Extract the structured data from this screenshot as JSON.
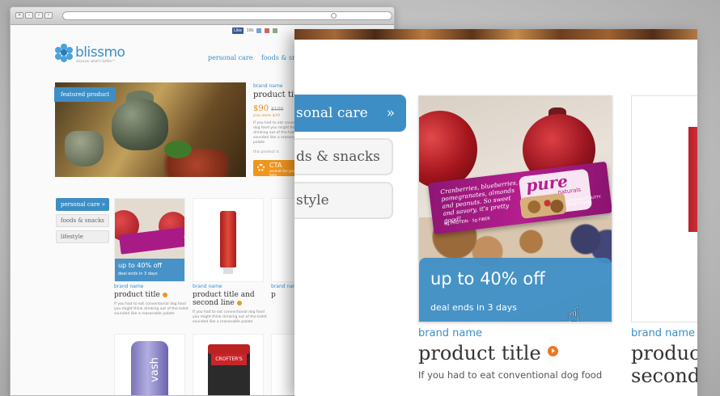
{
  "site": {
    "logo_text": "blissmo",
    "logo_tagline": "discover what's better™",
    "nav": [
      "personal care",
      "foods & snacks"
    ],
    "social": {
      "like": "Like",
      "count": "16k"
    }
  },
  "featured": {
    "tag": "featured product",
    "brand": "brand name",
    "title": "product title",
    "price": "$90",
    "old_price": "$100",
    "price_note": "you save $10",
    "desc": "If you had to eat conventional dog food you might think drinking out of the toilet sounded like a reasonable palate",
    "this_product": "this product is",
    "cta_label": "CTA",
    "cta_sub": "second line goes here"
  },
  "sidebar": {
    "items": [
      {
        "label": "personal care",
        "active": true
      },
      {
        "label": "foods & snacks",
        "active": false
      },
      {
        "label": "lifestyle",
        "active": false
      }
    ]
  },
  "grid": {
    "items": [
      {
        "brand": "brand name",
        "title": "product title",
        "deal": "up to 40% off",
        "deal_sub": "deal ends in 3 days",
        "desc": "If you had to eat conventional dog food you might think drinking out of the toilet sounded like a reasonable palate"
      },
      {
        "brand": "brand name",
        "title": "product title and second line",
        "desc": "If you had to eat conventional dog food you might think drinking out of the toilet sounded like a reasonable palate"
      },
      {
        "brand": "brand name",
        "title": "p"
      }
    ],
    "row2": [
      {
        "label": "vash"
      },
      {
        "label": "CROFTER'S"
      }
    ]
  },
  "zoom": {
    "nav": [
      {
        "label": "sonal care",
        "active": true
      },
      {
        "label": "ds & snacks",
        "active": false
      },
      {
        "label": "style",
        "active": false
      }
    ],
    "nav_chevron": "»",
    "card": {
      "bar_text": "Cranberries, blueberries, pomegranates, almonds and peanuts. So sweet and savory, it's pretty good!",
      "bar_sub": "6g PROTEIN · 5g FIBER",
      "bar_logo": "pure",
      "bar_logo2": "naturals",
      "bar_caption": "SUPERFRUIT NUTTY CRUNCH BAR",
      "deal": "up to 40% off",
      "deal_sub": "deal ends in 3 days",
      "brand": "brand name",
      "title": "product title",
      "desc": "If you had to eat conventional dog food"
    },
    "card2": {
      "brand": "brand name",
      "title_line1": "produc",
      "title_line2": "second"
    }
  },
  "colors": {
    "accent_blue": "#3e8ec6",
    "accent_orange": "#f0761e"
  }
}
